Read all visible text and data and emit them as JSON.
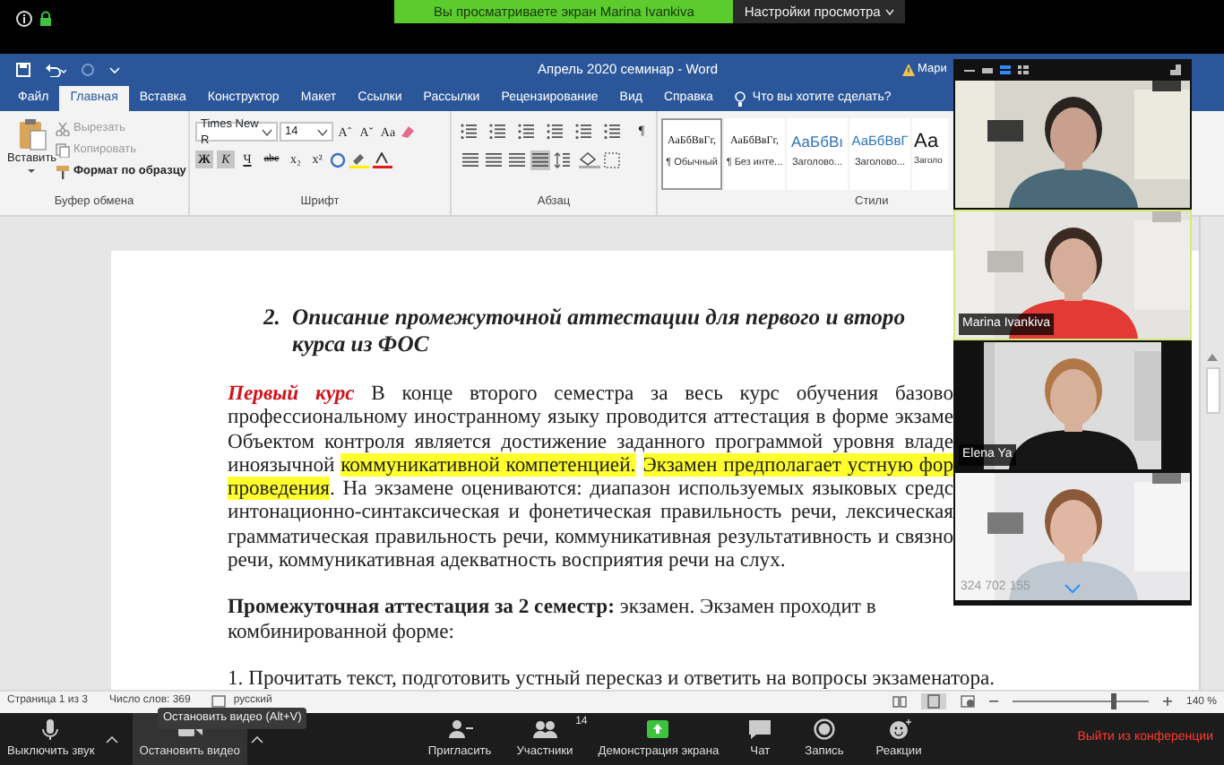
{
  "banner": {
    "text": "Вы просматриваете экран Marina Ivankiva",
    "settings": "Настройки просмотра"
  },
  "word": {
    "title": "Апрель 2020 семинар  -  Word",
    "account": "Мари",
    "tabs": [
      {
        "label": "Файл",
        "selected": false
      },
      {
        "label": "Главная",
        "selected": true
      },
      {
        "label": "Вставка",
        "selected": false
      },
      {
        "label": "Конструктор",
        "selected": false
      },
      {
        "label": "Макет",
        "selected": false
      },
      {
        "label": "Ссылки",
        "selected": false
      },
      {
        "label": "Рассылки",
        "selected": false
      },
      {
        "label": "Рецензирование",
        "selected": false
      },
      {
        "label": "Вид",
        "selected": false
      },
      {
        "label": "Справка",
        "selected": false
      }
    ],
    "tell_me": "Что вы хотите сделать?",
    "clipboard": {
      "paste": "Вставить",
      "label": "Буфер обмена",
      "actions": [
        {
          "label": "Вырезать",
          "kind": "cut",
          "disabled": true
        },
        {
          "label": "Копировать",
          "kind": "copy",
          "disabled": true
        },
        {
          "label": "Формат по образцу",
          "kind": "brush",
          "disabled": false
        }
      ]
    },
    "font": {
      "name": "Times New R",
      "size": "14",
      "label": "Шрифт",
      "size_buttons": [
        "Aˆ",
        "Aˇ",
        "Aa"
      ],
      "format_buttons": [
        {
          "label": "Ж",
          "kind": "bold",
          "on": true
        },
        {
          "label": "К",
          "kind": "italic",
          "on": true
        },
        {
          "label": "Ч",
          "kind": "underline",
          "on": false
        },
        {
          "label": "abc",
          "kind": "strike",
          "on": false
        },
        {
          "label": "x₂",
          "kind": "sub",
          "on": false
        },
        {
          "label": "x²",
          "kind": "sup",
          "on": false
        }
      ]
    },
    "paragraph": {
      "label": "Абзац",
      "pilcrow": "¶",
      "alignments": [
        {
          "selected": false
        },
        {
          "selected": false
        },
        {
          "selected": false
        },
        {
          "selected": true
        }
      ]
    },
    "styles": {
      "label": "Стили",
      "items": [
        {
          "sample": "АаБбВвГг,",
          "name": "¶ Обычный",
          "kind": "body",
          "selected": true
        },
        {
          "sample": "АаБбВвГг,",
          "name": "¶ Без инте...",
          "kind": "body",
          "selected": false
        },
        {
          "sample": "АаБбВı",
          "name": "Заголово...",
          "kind": "heading",
          "selected": false
        },
        {
          "sample": "АаБбВвГ",
          "name": "Заголово...",
          "kind": "subheading",
          "selected": false
        },
        {
          "sample": "Аа",
          "name": "Заголо",
          "kind": "title",
          "selected": false
        }
      ]
    },
    "document": {
      "heading": {
        "number": "2.",
        "lines": [
          "Описание промежуточной аттестации для первого и второ",
          "курса из ФОС"
        ]
      },
      "paragraphs": [
        {
          "lines": [
            {
              "justified": true,
              "segments": [
                {
                  "text": "Первый курс",
                  "kind": "accent"
                },
                {
                  "text": " В конце второго семестра за весь курс обучения базово",
                  "kind": "plain"
                }
              ]
            },
            {
              "justified": true,
              "segments": [
                {
                  "text": "профессиональному иностранному языку проводится аттестация в форме экзаме",
                  "kind": "plain"
                }
              ]
            },
            {
              "justified": true,
              "segments": [
                {
                  "text": "Объектом контроля является достижение заданного программой уровня владе",
                  "kind": "plain"
                }
              ]
            },
            {
              "justified": true,
              "segments": [
                {
                  "text": "иноязычной ",
                  "kind": "plain"
                },
                {
                  "text": "коммуникативной компетенцией.",
                  "kind": "highlight"
                },
                {
                  "text": "Экзамен предполагает устную фор",
                  "kind": "highlight"
                }
              ]
            },
            {
              "justified": true,
              "segments": [
                {
                  "text": "проведения",
                  "kind": "highlight"
                },
                {
                  "text": ". На экзамене оцениваются: диапазон используемых языковых средс",
                  "kind": "plain"
                }
              ]
            },
            {
              "justified": true,
              "segments": [
                {
                  "text": "интонационно-синтаксическая и фонетическая правильность речи, лексическая",
                  "kind": "plain"
                }
              ]
            },
            {
              "justified": true,
              "segments": [
                {
                  "text": "грамматическая правильность речи, коммуникативная результативность и связно",
                  "kind": "plain"
                }
              ]
            },
            {
              "justified": false,
              "segments": [
                {
                  "text": "речи, коммуникативная адекватность восприятия речи на слух.",
                  "kind": "plain"
                }
              ]
            }
          ]
        },
        {
          "lines": [
            {
              "justified": false,
              "segments": [
                {
                  "text": "Промежуточная аттестация за 2 семестр:",
                  "kind": "bold"
                },
                {
                  "text": " экзамен. Экзамен проходит в",
                  "kind": "plain"
                }
              ]
            },
            {
              "justified": false,
              "segments": [
                {
                  "text": "комбинированной форме:",
                  "kind": "plain"
                }
              ]
            }
          ]
        },
        {
          "lines": [
            {
              "justified": false,
              "segments": [
                {
                  "text": "1. Прочитать текст, подготовить устный пересказ и ответить на вопросы экзаменатора.",
                  "kind": "plain"
                }
              ]
            }
          ]
        }
      ]
    },
    "status_bar": {
      "page": "Страница 1 из 3",
      "words": "Число слов: 369",
      "language": "русский",
      "zoom": "140 %",
      "zoom_slider": {
        "level": 0.74
      }
    }
  },
  "video_tiles": [
    {
      "kind": "picture",
      "active": false
    },
    {
      "kind": "picture",
      "name": "Marina Ivankiva",
      "active": true
    },
    {
      "kind": "picture",
      "name": "Elena Ya",
      "active": false
    },
    {
      "kind": "picture",
      "active": false,
      "caption": "324 702 155"
    }
  ],
  "toolbar": {
    "buttons": [
      {
        "label": "Выключить звук",
        "kind": "mic",
        "caret": true,
        "highlighted": false
      },
      {
        "label": "Остановить видео",
        "kind": "video",
        "caret": true,
        "highlighted": true
      },
      {
        "label": "Пригласить",
        "kind": "invite",
        "caret": false,
        "highlighted": false
      },
      {
        "label": "Участники",
        "kind": "participants",
        "caret": false,
        "highlighted": false,
        "badge": "14"
      },
      {
        "label": "Демонстрация экрана",
        "kind": "share",
        "caret": false,
        "highlighted": false
      },
      {
        "label": "Чат",
        "kind": "chat",
        "caret": false,
        "highlighted": false
      },
      {
        "label": "Запись",
        "kind": "record",
        "caret": false,
        "highlighted": false
      },
      {
        "label": "Реакции",
        "kind": "reactions",
        "caret": false,
        "highlighted": false
      }
    ],
    "tooltip": "Остановить видео (Alt+V)",
    "leave": "Выйти из конференции"
  }
}
